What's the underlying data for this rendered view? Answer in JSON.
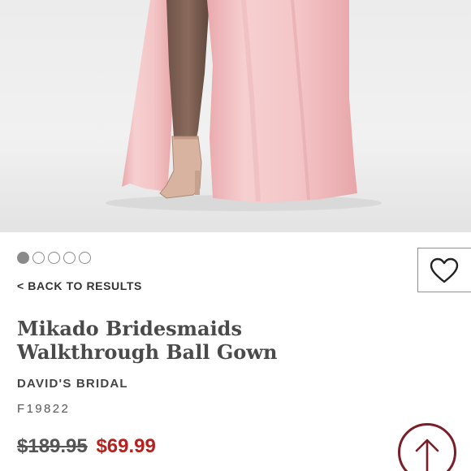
{
  "product_image": {
    "alt": "product-photo",
    "active_slide": 1,
    "total_slides": 5
  },
  "icons": {
    "favorite": "heart-outline-icon",
    "scroll_top": "arrow-up-circle-icon"
  },
  "nav": {
    "back_label": "< BACK TO RESULTS"
  },
  "product": {
    "title": "Mikado Bridesmaids Walkthrough Ball Gown",
    "brand": "DAVID'S BRIDAL",
    "sku": "F19822",
    "original_price": "$189.95",
    "sale_price": "$69.99"
  },
  "colors": {
    "sale": "#b3221e",
    "accent_circle": "#7a1f28",
    "dress": "#f3c4c4"
  }
}
